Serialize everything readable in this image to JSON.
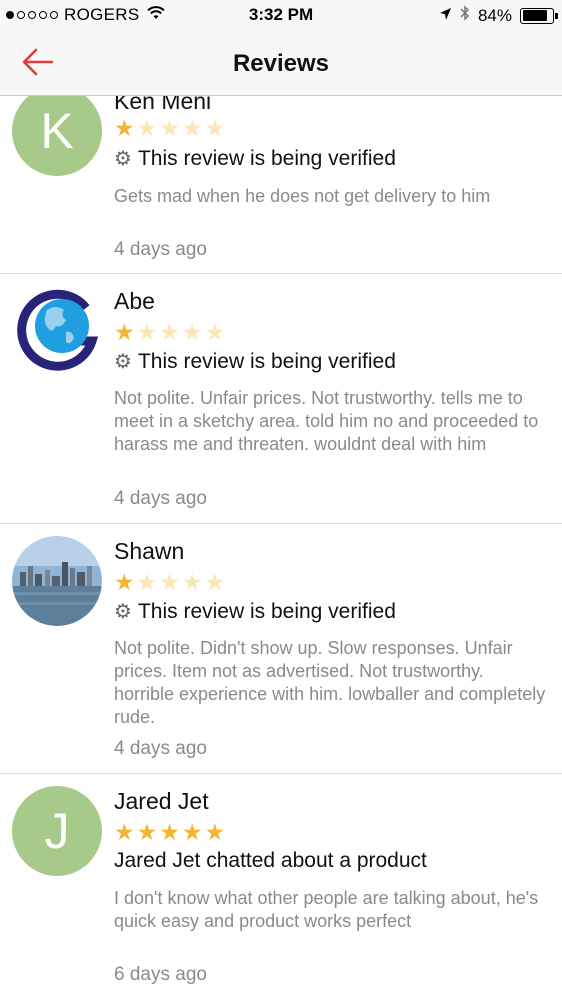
{
  "status_bar": {
    "carrier": "ROGERS",
    "time": "3:32 PM",
    "battery": "84%",
    "battery_level": 0.84,
    "signal_bars_filled": 1
  },
  "nav": {
    "title": "Reviews",
    "back_icon": "arrow-left-icon",
    "accent": "#e0393e"
  },
  "reviews": [
    {
      "name": "Ken Meni",
      "avatar_letter": "K",
      "rating": 1,
      "status": "This review is being verified",
      "text": "Gets mad when he does not get delivery to him",
      "time": "4 days ago"
    },
    {
      "name": "Abe",
      "avatar_icon": "globe-logo-icon",
      "rating": 1,
      "status": "This review is being verified",
      "text": "Not polite. Unfair prices. Not trustworthy. tells me to meet in a sketchy area. told him no and proceeded to harass me and threaten. wouldnt deal with him",
      "time": "4 days ago"
    },
    {
      "name": "Shawn",
      "avatar_icon": "city-skyline-photo",
      "rating": 1,
      "status": "This review is being verified",
      "text": "Not polite. Didn't show up. Slow responses. Unfair prices. Item not as advertised. Not trustworthy. horrible experience with him. lowballer and completely rude.",
      "time": "4 days ago"
    },
    {
      "name": "Jared Jet",
      "avatar_letter": "J",
      "rating": 5,
      "status": "Jared Jet chatted about a product",
      "text": "I don't know what other people are talking about, he's quick easy and product works perfect",
      "time": "6 days ago"
    }
  ],
  "colors": {
    "star_on": "#f2b632",
    "star_off": "#fbe7b5",
    "avatar_green": "#a7c98a"
  }
}
